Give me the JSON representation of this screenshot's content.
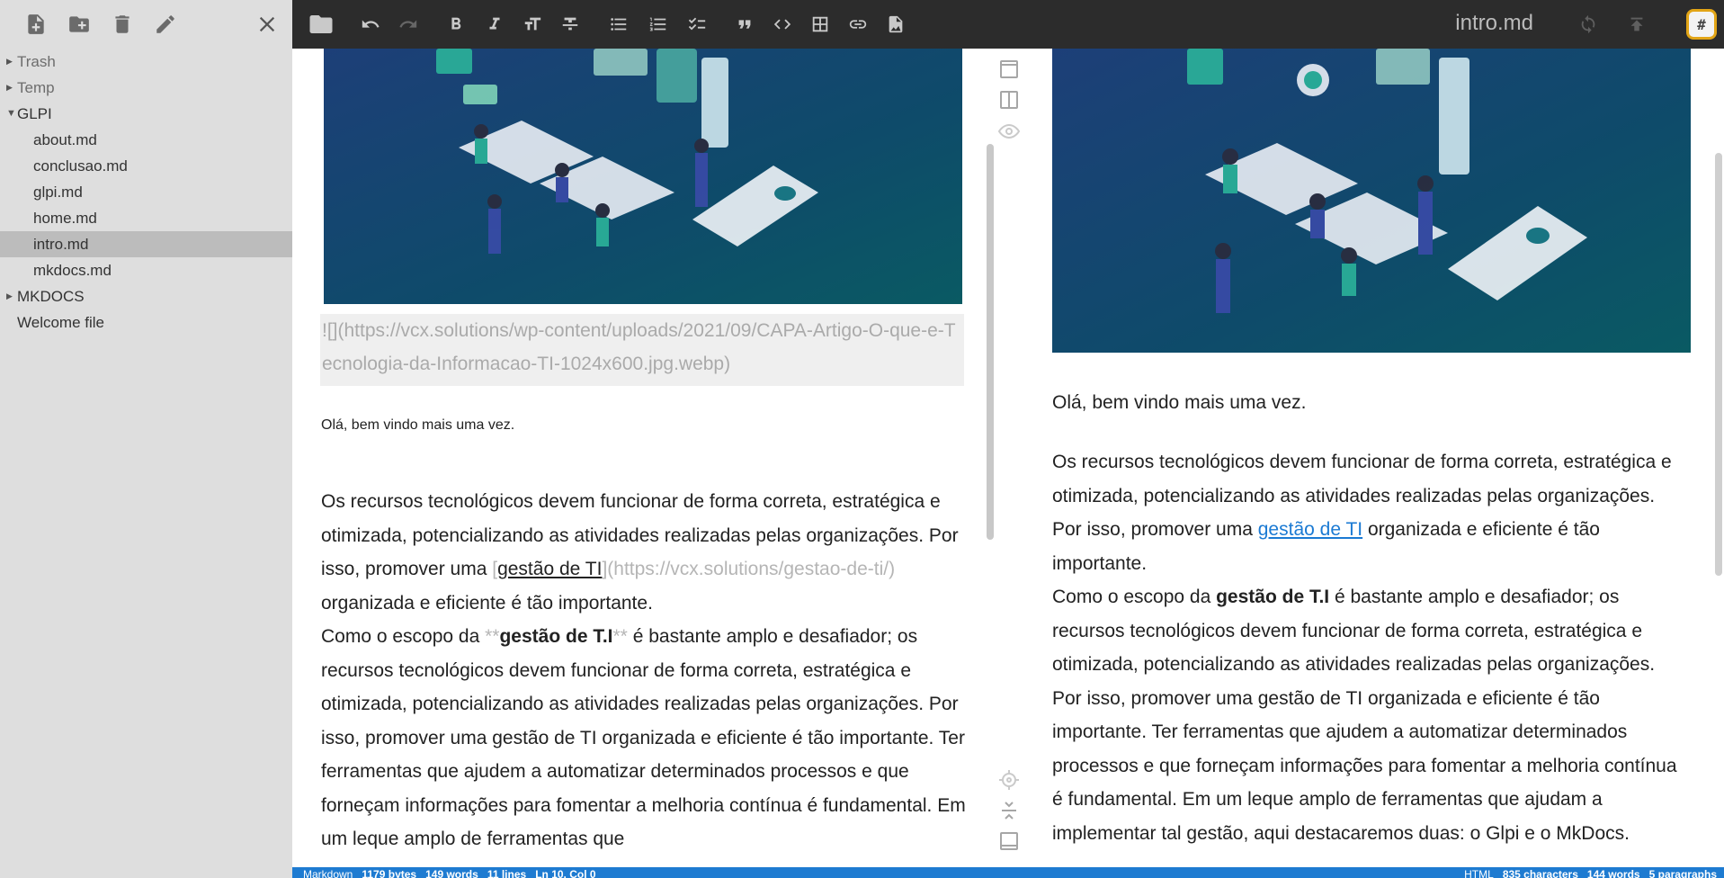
{
  "explorer": {
    "tree": [
      {
        "label": "Trash",
        "kind": "folder",
        "expanded": false
      },
      {
        "label": "Temp",
        "kind": "folder",
        "expanded": false
      },
      {
        "label": "GLPI",
        "kind": "folder",
        "expanded": true
      },
      {
        "label": "about.md",
        "kind": "file"
      },
      {
        "label": "conclusao.md",
        "kind": "file"
      },
      {
        "label": "glpi.md",
        "kind": "file"
      },
      {
        "label": "home.md",
        "kind": "file"
      },
      {
        "label": "intro.md",
        "kind": "file",
        "selected": true
      },
      {
        "label": "mkdocs.md",
        "kind": "file"
      },
      {
        "label": "MKDOCS",
        "kind": "folder",
        "expanded": false
      },
      {
        "label": "Welcome file",
        "kind": "file"
      }
    ]
  },
  "navbar": {
    "document_title": "intro.md",
    "workspace_label": "#"
  },
  "editor": {
    "image_markdown": "![](https://vcx.solutions/wp-content/uploads/2021/09/CAPA-Artigo-O-que-e-Tecnologia-da-Informacao-TI-1024x600.jpg.webp)",
    "p1": "Olá, bem vindo mais uma vez.",
    "p2_start": "Os recursos tecnológicos devem funcionar de forma correta, estratégica e otimizada, potencializando as atividades realizadas pelas organizações. Por isso, promover uma ",
    "p2_link_open": "[",
    "p2_link_text": "gestão de TI",
    "p2_link_url": "](https://vcx.solutions/gestao-de-ti/)",
    "p2_end": " organizada e eficiente é tão importante.",
    "p3_start": "Como o escopo da ",
    "p3_bold_marker": "**",
    "p3_bold_text": "gestão de T.I",
    "p3_end": " é bastante amplo e desafiador; os recursos tecnológicos devem funcionar de forma correta, estratégica e otimizada, potencializando as atividades realizadas pelas organizações. Por isso, promover uma gestão de TI organizada e eficiente é tão importante. Ter ferramentas que ajudem a automatizar determinados processos e que forneçam informações para fomentar a melhoria contínua é fundamental. Em um leque amplo de ferramentas que"
  },
  "preview": {
    "p1": "Olá, bem vindo mais uma vez.",
    "p2_start": "Os recursos tecnológicos devem funcionar de forma correta, estratégica e otimizada, potencializando as atividades realizadas pelas organizações. Por isso, promover uma ",
    "p2_link": "gestão de TI",
    "p2_end": " organizada e eficiente é tão importante.",
    "p3_start": "Como o escopo da ",
    "p3_bold": "gestão de T.I",
    "p3_end": " é bastante amplo e desafiador; os recursos tecnológicos devem funcionar de forma correta, estratégica e otimizada, potencializando as atividades realizadas pelas organizações. Por isso, promover uma gestão de TI organizada e eficiente é tão importante. Ter ferramentas que ajudem a automatizar determinados processos e que forneçam informações para fomentar a melhoria contínua é fundamental. Em um leque amplo de ferramentas que ajudam a implementar tal gestão, aqui destacaremos duas: o Glpi e o MkDocs."
  },
  "status_bar": {
    "left": {
      "mode": "Markdown",
      "bytes": "1179 bytes",
      "words": "149 words",
      "lines": "11 lines",
      "position": "Ln 10, Col 0"
    },
    "right": {
      "format": "HTML",
      "characters": "835 characters",
      "words": "144 words",
      "paragraphs": "5 paragraphs"
    }
  },
  "colors": {
    "sidebar_bg": "#dedede",
    "navbar_bg": "#2c2c2c",
    "status_bar_bg": "#1e7bd1",
    "link": "#1b7ad3",
    "image_bg": "#12384e"
  }
}
